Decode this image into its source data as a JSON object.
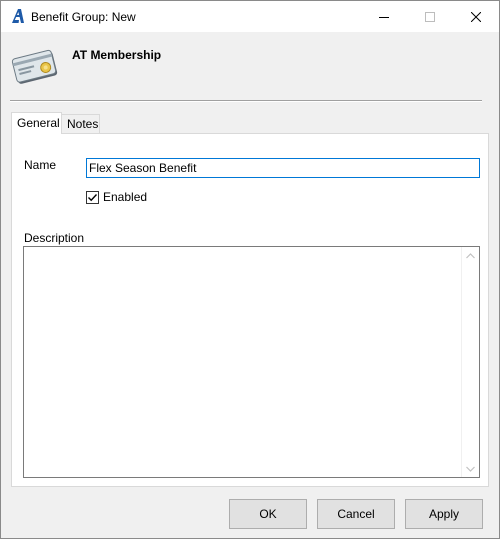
{
  "window": {
    "title": "Benefit Group: New",
    "icon": "aptify-logo-icon",
    "controls": [
      "minimize-icon",
      "maximize-icon",
      "close-icon"
    ]
  },
  "header": {
    "icon": "membership-card-icon",
    "title": "AT Membership"
  },
  "tabs": [
    {
      "label": "General",
      "active": true
    },
    {
      "label": "Notes",
      "active": false
    }
  ],
  "form": {
    "name_label": "Name",
    "name_value": "Flex Season Benefit",
    "enabled_label": "Enabled",
    "enabled_checked": true,
    "description_label": "Description",
    "description_value": ""
  },
  "buttons": {
    "ok": "OK",
    "cancel": "Cancel",
    "apply": "Apply"
  },
  "colors": {
    "accent": "#0078d7",
    "window_bg": "#f0f0f0",
    "logo_blue": "#1e5aa8"
  }
}
